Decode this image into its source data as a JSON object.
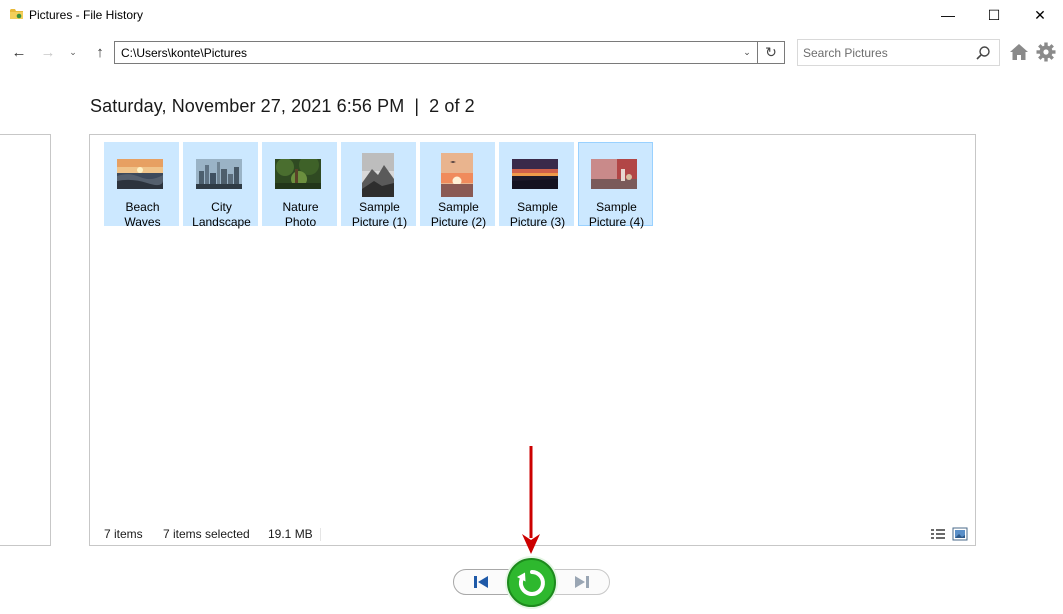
{
  "window": {
    "title": "Pictures - File History",
    "minimize_glyph": "—",
    "maximize_glyph": "☐",
    "close_glyph": "✕"
  },
  "nav": {
    "back_glyph": "←",
    "forward_glyph": "→",
    "recent_glyph": "⌄",
    "up_glyph": "↑",
    "address": "C:\\Users\\konte\\Pictures",
    "address_drop_glyph": "⌄",
    "refresh_glyph": "↻",
    "search_placeholder": "Search Pictures"
  },
  "header": {
    "date": "Saturday, November 27, 2021 6:56 PM",
    "separator": "|",
    "position": "2 of 2"
  },
  "files": [
    {
      "line1": "Beach",
      "line2": "Waves",
      "thumb": "beach"
    },
    {
      "line1": "City",
      "line2": "Landscape",
      "thumb": "city"
    },
    {
      "line1": "Nature",
      "line2": "Photo",
      "thumb": "nature"
    },
    {
      "line1": "Sample",
      "line2": "Picture (1)",
      "thumb": "mountain"
    },
    {
      "line1": "Sample",
      "line2": "Picture (2)",
      "thumb": "sunset"
    },
    {
      "line1": "Sample",
      "line2": "Picture (3)",
      "thumb": "dusk"
    },
    {
      "line1": "Sample",
      "line2": "Picture (4)",
      "thumb": "room"
    }
  ],
  "status": {
    "item_count": "7 items",
    "selected": "7 items selected",
    "size": "19.1 MB"
  },
  "colors": {
    "selection_bg": "#cce8ff",
    "restore_green": "#2eb82e",
    "annotation_red": "#cc0000"
  },
  "icons": {
    "app": "folder-icon",
    "search": "search-icon",
    "home": "home-icon",
    "settings": "gear-icon",
    "previous": "skip-previous-icon",
    "restore": "restore-icon",
    "next": "skip-next-icon"
  }
}
